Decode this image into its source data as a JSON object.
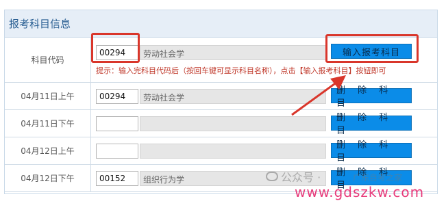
{
  "panel": {
    "title": "报考科目信息"
  },
  "first_row": {
    "label": "科目代码",
    "code": "00294",
    "name": "劳动社会学",
    "button": "输入报考科目",
    "hint": "提示：输入完科目代码后（按回车键可显示科目名称），点击【输入报考科目】按钮即可"
  },
  "rows": [
    {
      "label": "04月11日上午",
      "code": "00294",
      "name": "劳动社会学",
      "button": "删 除 科 目"
    },
    {
      "label": "04月11日下午",
      "code": "",
      "name": "",
      "button": "删 除 科 目"
    },
    {
      "label": "04月12日上午",
      "code": "",
      "name": "",
      "button": "删 除 科 目"
    },
    {
      "label": "04月12日下午",
      "code": "00152",
      "name": "组织行为学",
      "button": "删 除 科 目"
    }
  ],
  "watermark": {
    "text": "公众号 ·",
    "text2": "广东自考之家"
  },
  "footer": {
    "url": "www.gdszkw.com"
  },
  "colors": {
    "button_blue": "#0b8ce8",
    "annotation_red": "#d9362b",
    "hint_red": "#c0392b",
    "footer_pink": "#e83a7a"
  }
}
